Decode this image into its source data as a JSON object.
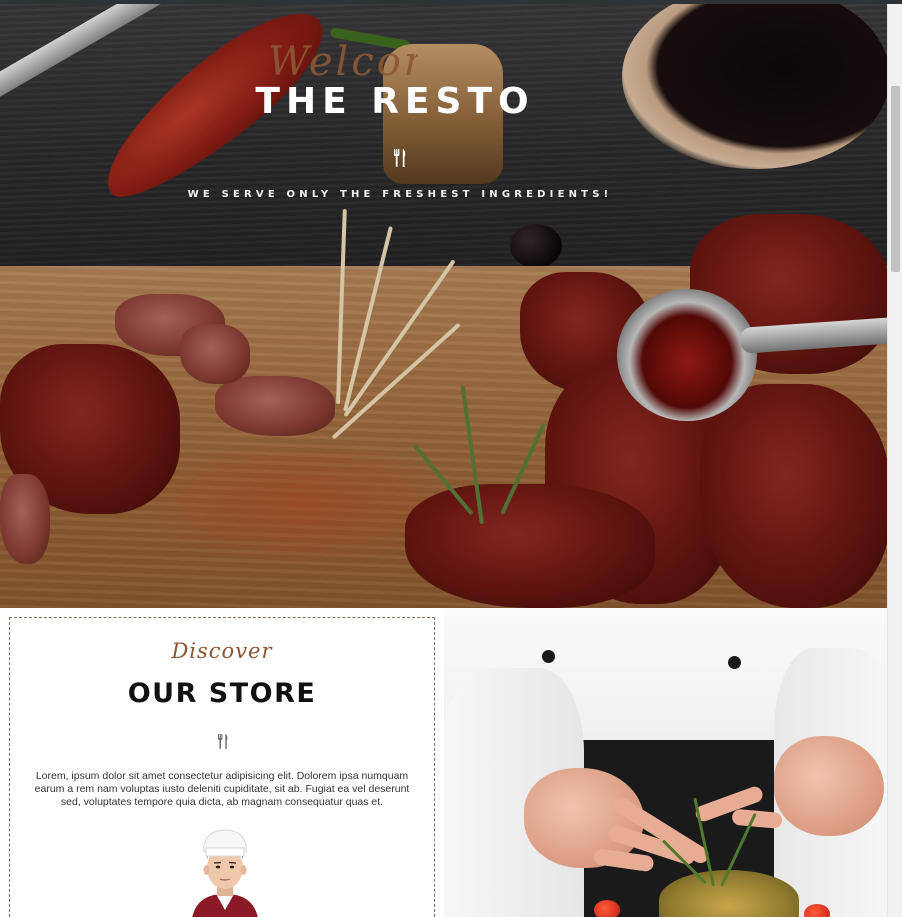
{
  "hero": {
    "welcome_script": "Welcome",
    "title": "THE RESTO",
    "tagline": "WE SERVE ONLY THE FRESHEST INGREDIENTS!",
    "icon": "utensils-icon"
  },
  "store": {
    "script": "Discover",
    "title": "OUR STORE",
    "icon": "utensils-icon",
    "text": "Lorem, ipsum dolor sit amet consectetur adipisicing elit. Dolorem ipsa numquam earum a rem nam voluptas iusto deleniti cupiditate, sit ab. Fugiat ea vel deserunt sed, voluptates tempore quia dicta, ab magnam consequatur quas et.",
    "avatar": "chef-avatar"
  },
  "colors": {
    "accent_brown": "#8a5533",
    "dashed_border": "#8a6a52",
    "title_dark": "#111111",
    "hero_text": "#ffffff"
  }
}
